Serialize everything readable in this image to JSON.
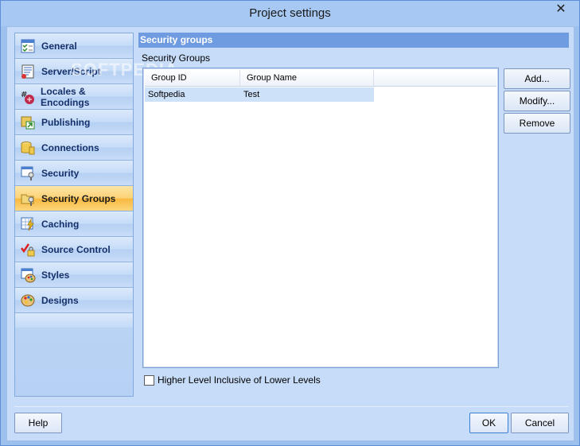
{
  "window": {
    "title": "Project settings",
    "close_glyph": "✕",
    "watermark": "SOFTPEDIA"
  },
  "sidebar": {
    "items": [
      {
        "label": "General",
        "icon": "checklist-icon",
        "active": false
      },
      {
        "label": "Server/Script",
        "icon": "server-script-icon",
        "active": false
      },
      {
        "label": "Locales & Encodings",
        "icon": "locale-icon",
        "active": false
      },
      {
        "label": "Publishing",
        "icon": "publish-icon",
        "active": false
      },
      {
        "label": "Connections",
        "icon": "database-icon",
        "active": false
      },
      {
        "label": "Security",
        "icon": "key-table-icon",
        "active": false
      },
      {
        "label": "Security Groups",
        "icon": "key-folder-icon",
        "active": true
      },
      {
        "label": "Caching",
        "icon": "lightning-table-icon",
        "active": false
      },
      {
        "label": "Source Control",
        "icon": "lock-check-icon",
        "active": false
      },
      {
        "label": "Styles",
        "icon": "palette-table-icon",
        "active": false
      },
      {
        "label": "Designs",
        "icon": "palette-icon",
        "active": false
      }
    ]
  },
  "main": {
    "header": "Security groups",
    "group_label": "Security Groups",
    "columns": [
      "Group ID",
      "Group Name"
    ],
    "rows": [
      {
        "group_id": "Softpedia",
        "group_name": "Test"
      }
    ],
    "checkbox": {
      "label": "Higher Level Inclusive of Lower Levels",
      "checked": false
    }
  },
  "buttons": {
    "add": "Add...",
    "modify": "Modify...",
    "remove": "Remove",
    "help": "Help",
    "ok": "OK",
    "cancel": "Cancel"
  },
  "colors": {
    "accent": "#6f9be0",
    "active_item": "#f9b83e",
    "selection": "#cde1f9"
  }
}
